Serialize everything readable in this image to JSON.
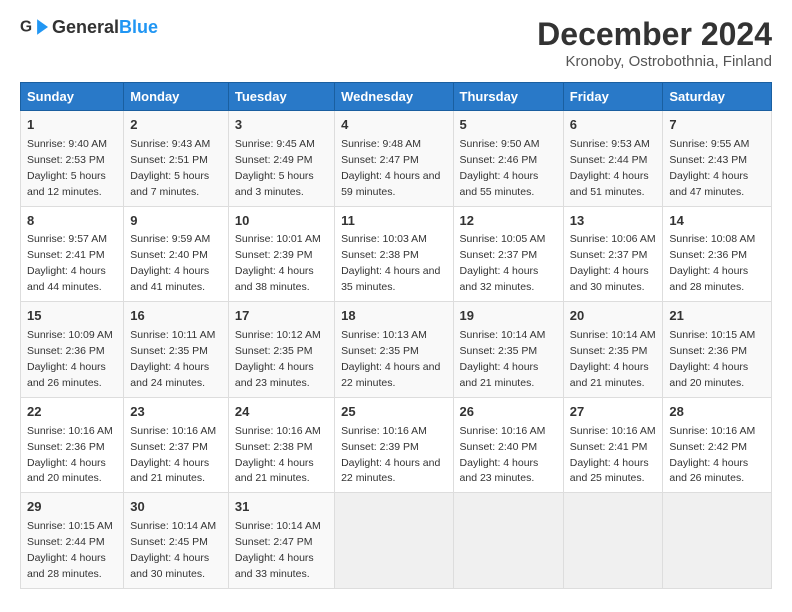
{
  "header": {
    "logo_general": "General",
    "logo_blue": "Blue",
    "title": "December 2024",
    "subtitle": "Kronoby, Ostrobothnia, Finland"
  },
  "columns": [
    "Sunday",
    "Monday",
    "Tuesday",
    "Wednesday",
    "Thursday",
    "Friday",
    "Saturday"
  ],
  "weeks": [
    [
      {
        "day": "1",
        "sunrise": "Sunrise: 9:40 AM",
        "sunset": "Sunset: 2:53 PM",
        "daylight": "Daylight: 5 hours and 12 minutes."
      },
      {
        "day": "2",
        "sunrise": "Sunrise: 9:43 AM",
        "sunset": "Sunset: 2:51 PM",
        "daylight": "Daylight: 5 hours and 7 minutes."
      },
      {
        "day": "3",
        "sunrise": "Sunrise: 9:45 AM",
        "sunset": "Sunset: 2:49 PM",
        "daylight": "Daylight: 5 hours and 3 minutes."
      },
      {
        "day": "4",
        "sunrise": "Sunrise: 9:48 AM",
        "sunset": "Sunset: 2:47 PM",
        "daylight": "Daylight: 4 hours and 59 minutes."
      },
      {
        "day": "5",
        "sunrise": "Sunrise: 9:50 AM",
        "sunset": "Sunset: 2:46 PM",
        "daylight": "Daylight: 4 hours and 55 minutes."
      },
      {
        "day": "6",
        "sunrise": "Sunrise: 9:53 AM",
        "sunset": "Sunset: 2:44 PM",
        "daylight": "Daylight: 4 hours and 51 minutes."
      },
      {
        "day": "7",
        "sunrise": "Sunrise: 9:55 AM",
        "sunset": "Sunset: 2:43 PM",
        "daylight": "Daylight: 4 hours and 47 minutes."
      }
    ],
    [
      {
        "day": "8",
        "sunrise": "Sunrise: 9:57 AM",
        "sunset": "Sunset: 2:41 PM",
        "daylight": "Daylight: 4 hours and 44 minutes."
      },
      {
        "day": "9",
        "sunrise": "Sunrise: 9:59 AM",
        "sunset": "Sunset: 2:40 PM",
        "daylight": "Daylight: 4 hours and 41 minutes."
      },
      {
        "day": "10",
        "sunrise": "Sunrise: 10:01 AM",
        "sunset": "Sunset: 2:39 PM",
        "daylight": "Daylight: 4 hours and 38 minutes."
      },
      {
        "day": "11",
        "sunrise": "Sunrise: 10:03 AM",
        "sunset": "Sunset: 2:38 PM",
        "daylight": "Daylight: 4 hours and 35 minutes."
      },
      {
        "day": "12",
        "sunrise": "Sunrise: 10:05 AM",
        "sunset": "Sunset: 2:37 PM",
        "daylight": "Daylight: 4 hours and 32 minutes."
      },
      {
        "day": "13",
        "sunrise": "Sunrise: 10:06 AM",
        "sunset": "Sunset: 2:37 PM",
        "daylight": "Daylight: 4 hours and 30 minutes."
      },
      {
        "day": "14",
        "sunrise": "Sunrise: 10:08 AM",
        "sunset": "Sunset: 2:36 PM",
        "daylight": "Daylight: 4 hours and 28 minutes."
      }
    ],
    [
      {
        "day": "15",
        "sunrise": "Sunrise: 10:09 AM",
        "sunset": "Sunset: 2:36 PM",
        "daylight": "Daylight: 4 hours and 26 minutes."
      },
      {
        "day": "16",
        "sunrise": "Sunrise: 10:11 AM",
        "sunset": "Sunset: 2:35 PM",
        "daylight": "Daylight: 4 hours and 24 minutes."
      },
      {
        "day": "17",
        "sunrise": "Sunrise: 10:12 AM",
        "sunset": "Sunset: 2:35 PM",
        "daylight": "Daylight: 4 hours and 23 minutes."
      },
      {
        "day": "18",
        "sunrise": "Sunrise: 10:13 AM",
        "sunset": "Sunset: 2:35 PM",
        "daylight": "Daylight: 4 hours and 22 minutes."
      },
      {
        "day": "19",
        "sunrise": "Sunrise: 10:14 AM",
        "sunset": "Sunset: 2:35 PM",
        "daylight": "Daylight: 4 hours and 21 minutes."
      },
      {
        "day": "20",
        "sunrise": "Sunrise: 10:14 AM",
        "sunset": "Sunset: 2:35 PM",
        "daylight": "Daylight: 4 hours and 21 minutes."
      },
      {
        "day": "21",
        "sunrise": "Sunrise: 10:15 AM",
        "sunset": "Sunset: 2:36 PM",
        "daylight": "Daylight: 4 hours and 20 minutes."
      }
    ],
    [
      {
        "day": "22",
        "sunrise": "Sunrise: 10:16 AM",
        "sunset": "Sunset: 2:36 PM",
        "daylight": "Daylight: 4 hours and 20 minutes."
      },
      {
        "day": "23",
        "sunrise": "Sunrise: 10:16 AM",
        "sunset": "Sunset: 2:37 PM",
        "daylight": "Daylight: 4 hours and 21 minutes."
      },
      {
        "day": "24",
        "sunrise": "Sunrise: 10:16 AM",
        "sunset": "Sunset: 2:38 PM",
        "daylight": "Daylight: 4 hours and 21 minutes."
      },
      {
        "day": "25",
        "sunrise": "Sunrise: 10:16 AM",
        "sunset": "Sunset: 2:39 PM",
        "daylight": "Daylight: 4 hours and 22 minutes."
      },
      {
        "day": "26",
        "sunrise": "Sunrise: 10:16 AM",
        "sunset": "Sunset: 2:40 PM",
        "daylight": "Daylight: 4 hours and 23 minutes."
      },
      {
        "day": "27",
        "sunrise": "Sunrise: 10:16 AM",
        "sunset": "Sunset: 2:41 PM",
        "daylight": "Daylight: 4 hours and 25 minutes."
      },
      {
        "day": "28",
        "sunrise": "Sunrise: 10:16 AM",
        "sunset": "Sunset: 2:42 PM",
        "daylight": "Daylight: 4 hours and 26 minutes."
      }
    ],
    [
      {
        "day": "29",
        "sunrise": "Sunrise: 10:15 AM",
        "sunset": "Sunset: 2:44 PM",
        "daylight": "Daylight: 4 hours and 28 minutes."
      },
      {
        "day": "30",
        "sunrise": "Sunrise: 10:14 AM",
        "sunset": "Sunset: 2:45 PM",
        "daylight": "Daylight: 4 hours and 30 minutes."
      },
      {
        "day": "31",
        "sunrise": "Sunrise: 10:14 AM",
        "sunset": "Sunset: 2:47 PM",
        "daylight": "Daylight: 4 hours and 33 minutes."
      },
      null,
      null,
      null,
      null
    ]
  ]
}
